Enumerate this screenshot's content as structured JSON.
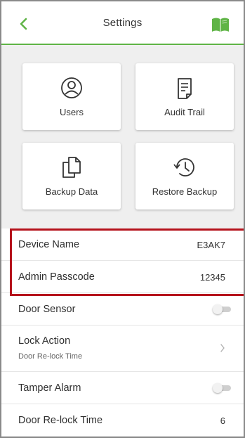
{
  "header": {
    "title": "Settings",
    "back_icon": "chevron-left-icon",
    "manual_icon": "book-icon",
    "accent_color": "#5fb446"
  },
  "tiles": [
    {
      "label": "Users",
      "icon": "user-circle-icon"
    },
    {
      "label": "Audit Trail",
      "icon": "document-list-icon"
    },
    {
      "label": "Backup Data",
      "icon": "copy-files-icon"
    },
    {
      "label": "Restore Backup",
      "icon": "history-clock-icon"
    }
  ],
  "settings": {
    "device_name": {
      "label": "Device Name",
      "value": "E3AK7"
    },
    "admin_passcode": {
      "label": "Admin Passcode",
      "value": "12345"
    },
    "door_sensor": {
      "label": "Door Sensor",
      "enabled": false
    },
    "lock_action": {
      "label": "Lock Action",
      "sublabel": "Door Re-lock Time"
    },
    "tamper_alarm": {
      "label": "Tamper Alarm",
      "enabled": false
    },
    "door_relock_time": {
      "label": "Door Re-lock Time",
      "value": "6"
    }
  },
  "highlight_color": "#b5121b"
}
